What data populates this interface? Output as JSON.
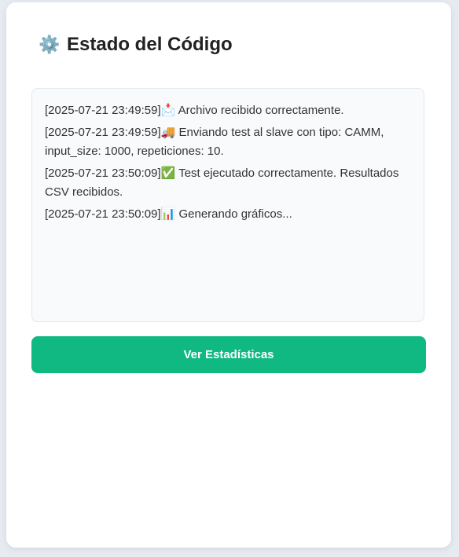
{
  "header": {
    "icon": "gear-icon",
    "icon_glyph": "⚙️",
    "title": "Estado del Código"
  },
  "log": {
    "entries": [
      {
        "timestamp": "[2025-07-21 23:49:59]",
        "icon": "📩",
        "text": " Archivo recibido correctamente."
      },
      {
        "timestamp": "[2025-07-21 23:49:59]",
        "icon": "🚚",
        "text": " Enviando test al slave con tipo: CAMM, input_size: 1000, repeticiones: 10."
      },
      {
        "timestamp": "[2025-07-21 23:50:09]",
        "icon": "✅",
        "text": " Test ejecutado correctamente. Resultados CSV recibidos."
      },
      {
        "timestamp": "[2025-07-21 23:50:09]",
        "icon": "📊",
        "text": " Generando gráficos..."
      }
    ]
  },
  "actions": {
    "stats_label": "Ver Estadísticas"
  },
  "colors": {
    "accent": "#10b981"
  }
}
